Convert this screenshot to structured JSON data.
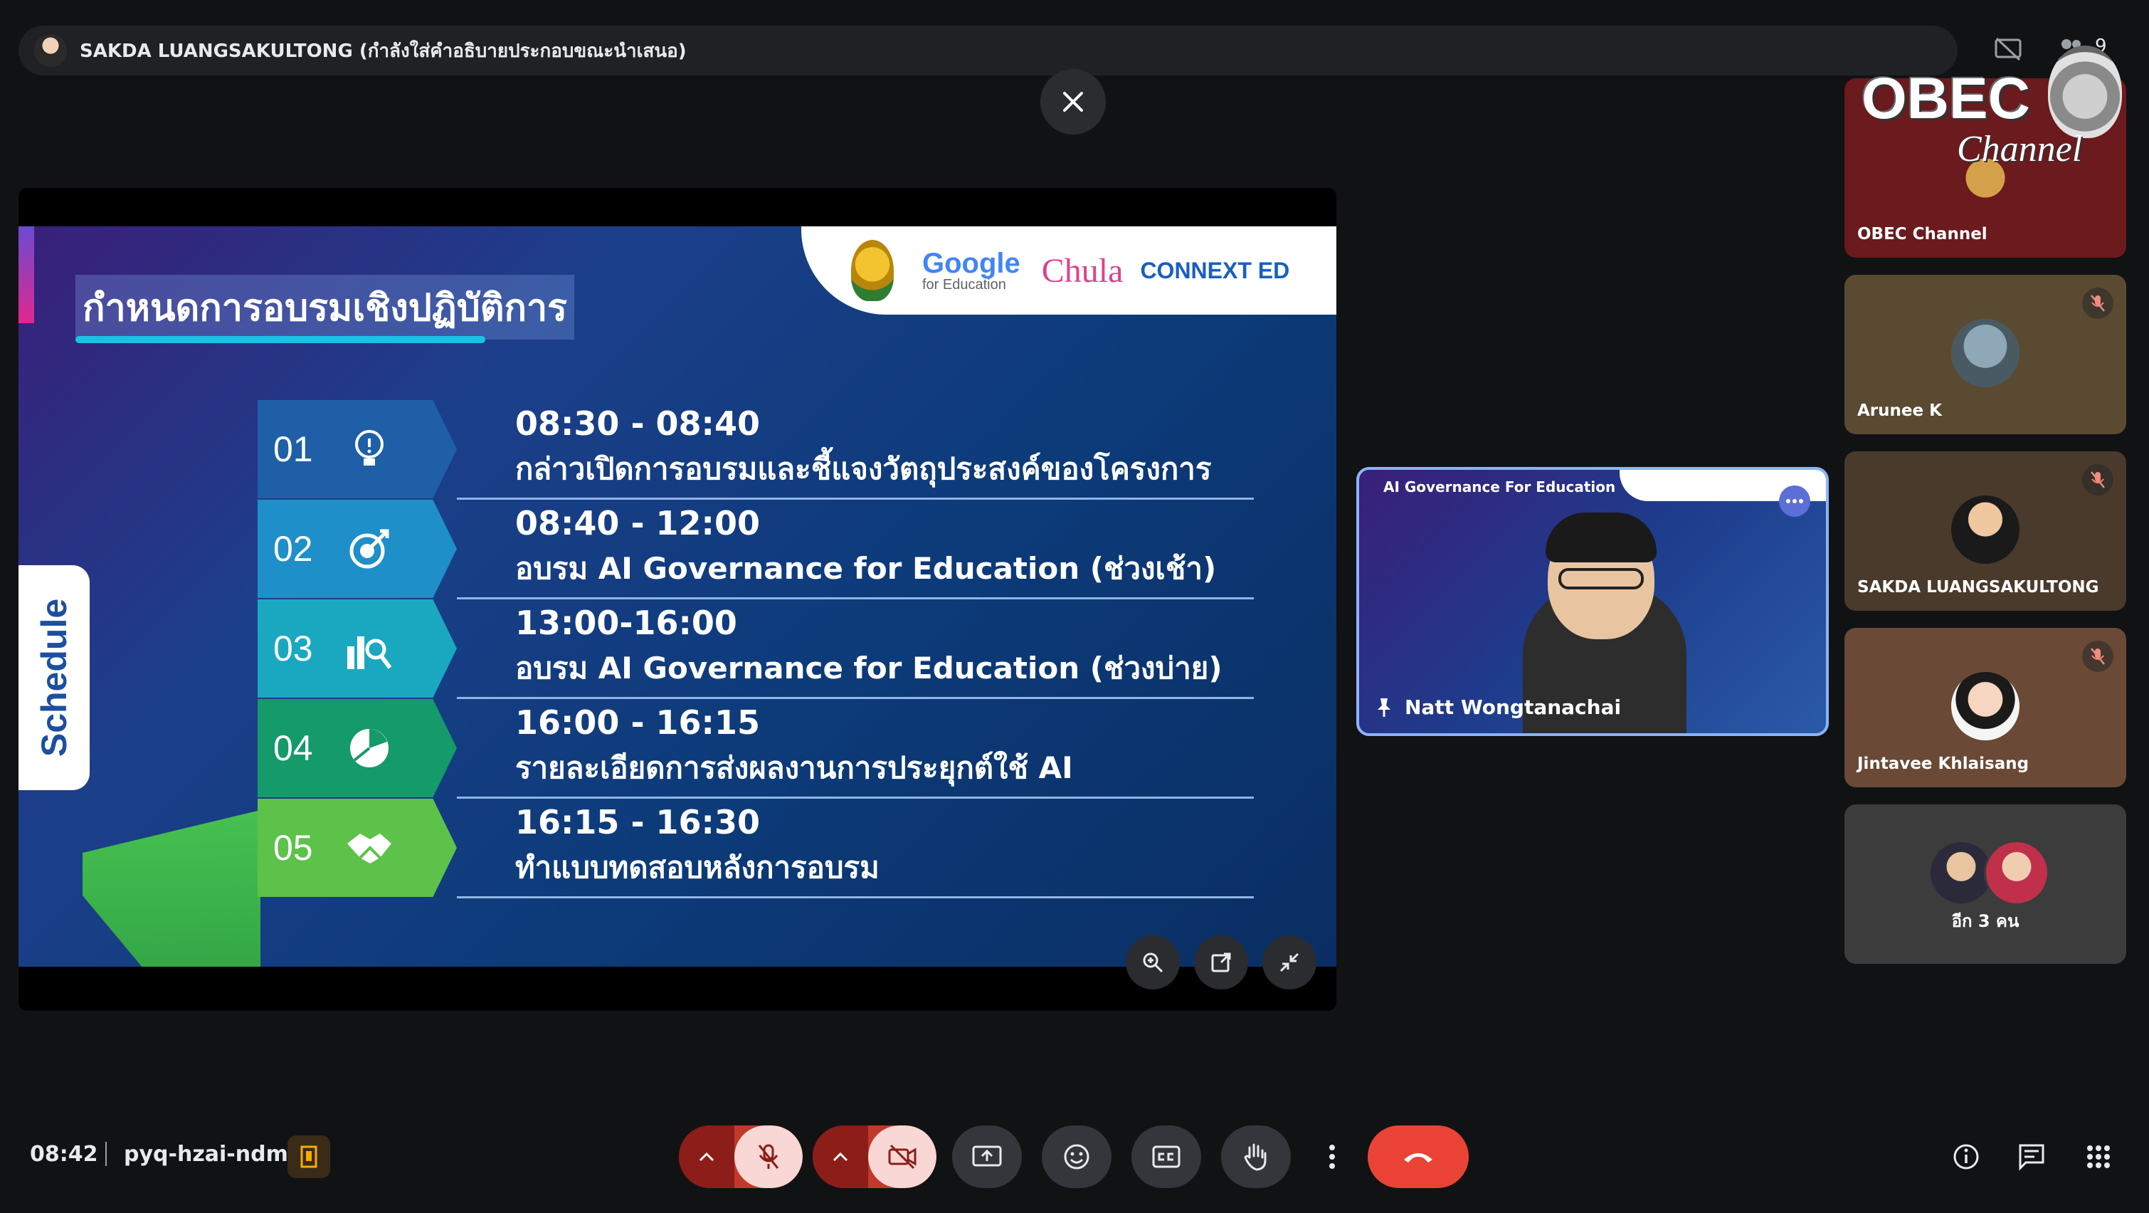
{
  "topbar": {
    "caption": "SAKDA LUANGSAKULTONG (กำลังใส่คำอธิบายประกอบขณะนำเสนอ)",
    "people_count": "9"
  },
  "slide": {
    "title": "กำหนดการอบรมเชิงปฏิบัติการ",
    "side_label": "Schedule",
    "logos": {
      "google": "Google",
      "google_sub": "for Education",
      "chula": "Chula",
      "connext": "CONNEXT ED"
    },
    "rows": [
      {
        "num": "01",
        "time": "08:30 - 08:40",
        "desc": "กล่าวเปิดการอบรมและชี้แจงวัตถุประสงค์ของโครงการ",
        "color": "#1e5fa8",
        "icon": "lightbulb-icon"
      },
      {
        "num": "02",
        "time": "08:40 - 12:00",
        "desc": "อบรม AI Governance for Education (ช่วงเช้า)",
        "color": "#1e8fc8",
        "icon": "target-icon"
      },
      {
        "num": "03",
        "time": "13:00-16:00",
        "desc": "อบรม AI Governance for Education (ช่วงบ่าย)",
        "color": "#1aa8c0",
        "icon": "chart-search-icon"
      },
      {
        "num": "04",
        "time": "16:00 - 16:15",
        "desc": "รายละเอียดการส่งผลงานการประยุกต์ใช้ AI",
        "color": "#159a6a",
        "icon": "pie-chart-icon"
      },
      {
        "num": "05",
        "time": "16:15 - 16:30",
        "desc": "ทำแบบทดสอบหลังการอบรม",
        "color": "#5cc24a",
        "icon": "handshake-icon"
      }
    ]
  },
  "speaker": {
    "slide_title": "AI Governance For Education",
    "name": "Natt Wongtanachai"
  },
  "participants": [
    {
      "name": "OBEC Channel",
      "bg": "#6b1a1e"
    },
    {
      "name": "Arunee K",
      "bg": "#5a4a32"
    },
    {
      "name": "SAKDA LUANGSAKULTONG",
      "bg": "#4a3a2c"
    },
    {
      "name": "Jintavee Khlaisang",
      "bg": "#6a4a36"
    }
  ],
  "more_participants": "อีก 3 คน",
  "obec_logo": {
    "title": "OBEC",
    "subtitle": "Channel"
  },
  "bottom": {
    "time": "08:42",
    "meeting_code": "pyq-hzai-ndm"
  }
}
